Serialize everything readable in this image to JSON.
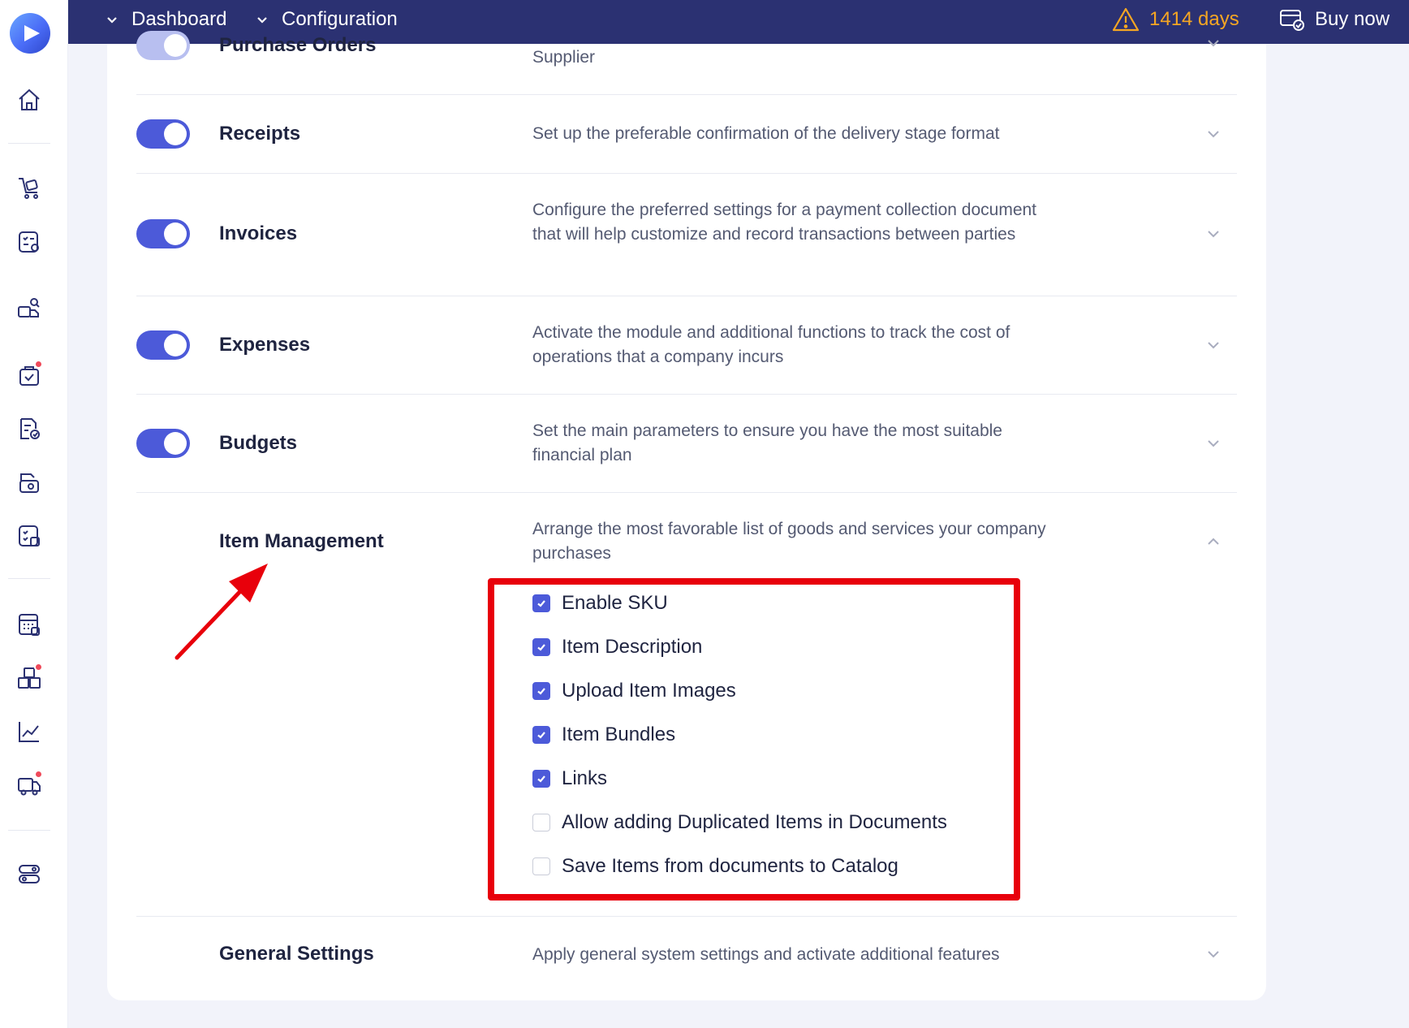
{
  "topbar": {
    "crumb_dashboard": "Dashboard",
    "crumb_configuration": "Configuration",
    "trial_days": "1414 days",
    "buy_now": "Buy now"
  },
  "sidebar": {
    "items": [
      {
        "icon": "home-icon"
      },
      {
        "icon": "cart-icon"
      },
      {
        "icon": "approval-list-icon"
      },
      {
        "icon": "supplier-search-icon"
      },
      {
        "icon": "task-bag-icon",
        "badge": true
      },
      {
        "icon": "invoice-check-icon"
      },
      {
        "icon": "wallet-doc-icon"
      },
      {
        "icon": "budget-list-icon"
      },
      {
        "icon": "calculator-icon"
      },
      {
        "icon": "inventory-boxes-icon",
        "badge": true
      },
      {
        "icon": "analytics-chart-icon"
      },
      {
        "icon": "delivery-truck-icon",
        "badge": true
      },
      {
        "icon": "settings-toggles-icon"
      }
    ]
  },
  "rows": {
    "purchase_orders": {
      "title": "Purchase Orders",
      "desc": "Supplier"
    },
    "receipts": {
      "title": "Receipts",
      "desc": "Set up the preferable confirmation of the delivery stage format"
    },
    "invoices": {
      "title": "Invoices",
      "desc": "Configure the preferred settings for a payment collection document that will help customize and record transactions between parties"
    },
    "expenses": {
      "title": "Expenses",
      "desc": "Activate the module and additional functions to track the cost of operations that a company incurs"
    },
    "budgets": {
      "title": "Budgets",
      "desc": "Set the main parameters to ensure you have the most suitable financial plan"
    },
    "item_management": {
      "title": "Item Management",
      "desc": "Arrange the most favorable list of goods and services your company purchases"
    },
    "general_settings": {
      "title": "General Settings",
      "desc": "Apply general system settings and activate additional features"
    }
  },
  "item_options": [
    {
      "label": "Enable SKU",
      "checked": true
    },
    {
      "label": "Item Description",
      "checked": true
    },
    {
      "label": "Upload Item Images",
      "checked": true
    },
    {
      "label": "Item Bundles",
      "checked": true
    },
    {
      "label": "Links",
      "checked": true
    },
    {
      "label": "Allow adding Duplicated Items in Documents",
      "checked": false
    },
    {
      "label": "Save Items from documents to Catalog",
      "checked": false
    }
  ],
  "colors": {
    "topbar": "#2b3172",
    "accent": "#4c5ad9",
    "warning": "#f5a623",
    "highlight": "#e8000b"
  }
}
